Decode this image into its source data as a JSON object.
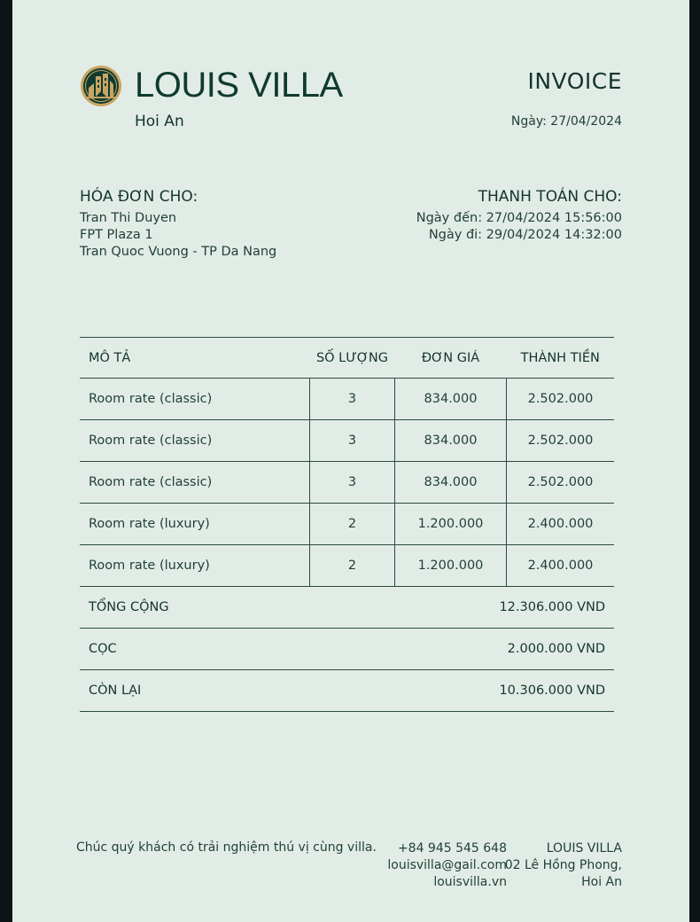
{
  "header": {
    "brand_name": "LOUIS VILLA",
    "city": "Hoi An",
    "doc_title": "INVOICE",
    "date_line": "Ngày: 27/04/2024",
    "logo_icon": "villa-building-icon"
  },
  "bill_to": {
    "heading": "HÓA ĐƠN CHO:",
    "lines": [
      "Tran Thi Duyen",
      "FPT Plaza 1",
      "Tran Quoc Vuong - TP Da Nang"
    ]
  },
  "pay_to": {
    "heading": "THANH TOÁN CHO:",
    "lines": [
      "Ngày đến: 27/04/2024 15:56:00",
      "Ngày đi: 29/04/2024 14:32:00"
    ]
  },
  "table": {
    "headers": [
      "MÔ TẢ",
      "SỐ LƯỢNG",
      "ĐƠN GIÁ",
      "THÀNH TIỀN"
    ],
    "rows": [
      [
        "Room rate (classic)",
        "3",
        "834.000",
        "2.502.000"
      ],
      [
        "Room rate (classic)",
        "3",
        "834.000",
        "2.502.000"
      ],
      [
        "Room rate (classic)",
        "3",
        "834.000",
        "2.502.000"
      ],
      [
        "Room rate (luxury)",
        "2",
        "1.200.000",
        "2.400.000"
      ],
      [
        "Room rate (luxury)",
        "2",
        "1.200.000",
        "2.400.000"
      ]
    ],
    "summary": [
      {
        "label": "TỔNG CỘNG",
        "value": "12.306.000 VND"
      },
      {
        "label": "CỌC",
        "value": "2.000.000 VND"
      },
      {
        "label": "CÒN  LẠI",
        "value": "10.306.000 VND"
      }
    ]
  },
  "footer": {
    "thanks": "Chúc quý khách có trải nghiệm thú vị cùng villa.",
    "contact": [
      "+84 945 545 648",
      "louisvilla@gail.com",
      "louisvilla.vn"
    ],
    "address": [
      "LOUIS VILLA",
      "02 Lê Hồng Phong,",
      "Hoi An"
    ]
  },
  "colors": {
    "page_bg": "#e2ece6",
    "outer_bg": "#0c1418",
    "brand_green": "#0f3b2e",
    "logo_gold": "#c9a564"
  }
}
